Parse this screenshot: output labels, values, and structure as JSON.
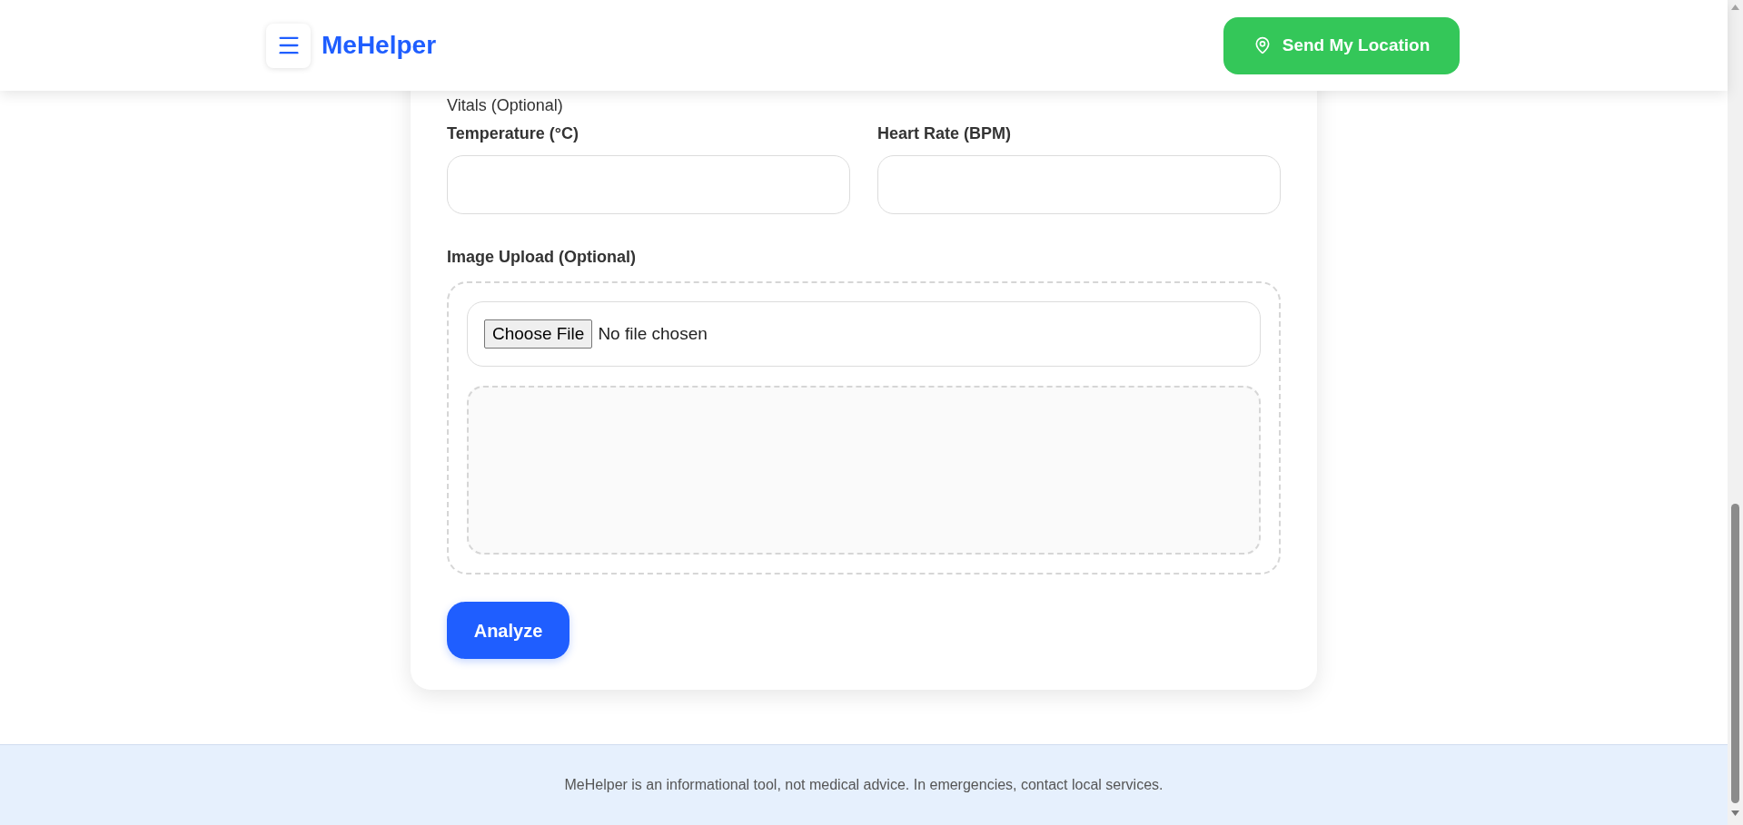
{
  "header": {
    "title": "MeHelper",
    "location_button": "Send My Location"
  },
  "form": {
    "section_label": "Vitals (Optional)",
    "fields": [
      {
        "label": "Temperature (°C)"
      },
      {
        "label": "Heart Rate (BPM)"
      }
    ],
    "upload": {
      "label": "Image Upload (Optional)",
      "button": "Choose File",
      "status": "No file chosen"
    },
    "submit": "Analyze"
  },
  "footer": {
    "text": "MeHelper is an informational tool, not medical advice. In emergencies, contact local services."
  }
}
